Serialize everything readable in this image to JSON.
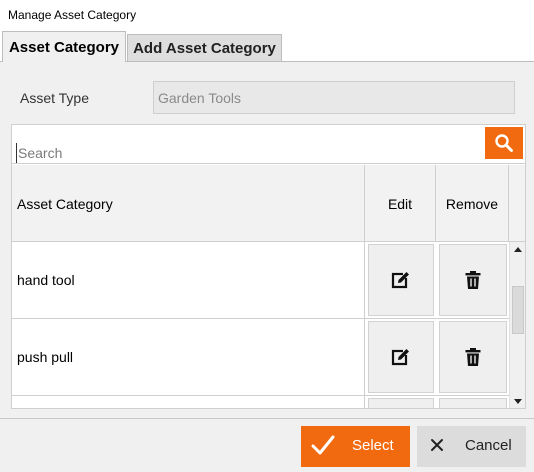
{
  "window": {
    "title": "Manage Asset Category"
  },
  "tabs": [
    {
      "label": "Asset Category",
      "active": true
    },
    {
      "label": "Add Asset Category",
      "active": false
    }
  ],
  "asset_type": {
    "label": "Asset Type",
    "value": "Garden Tools"
  },
  "search": {
    "placeholder": "Search",
    "value": ""
  },
  "table": {
    "columns": [
      "Asset Category",
      "Edit",
      "Remove"
    ],
    "rows": [
      {
        "name": "hand tool"
      },
      {
        "name": "push pull"
      }
    ]
  },
  "footer": {
    "select_label": "Select",
    "cancel_label": "Cancel"
  },
  "colors": {
    "accent": "#f26a10",
    "panel": "#f0f0f0"
  }
}
